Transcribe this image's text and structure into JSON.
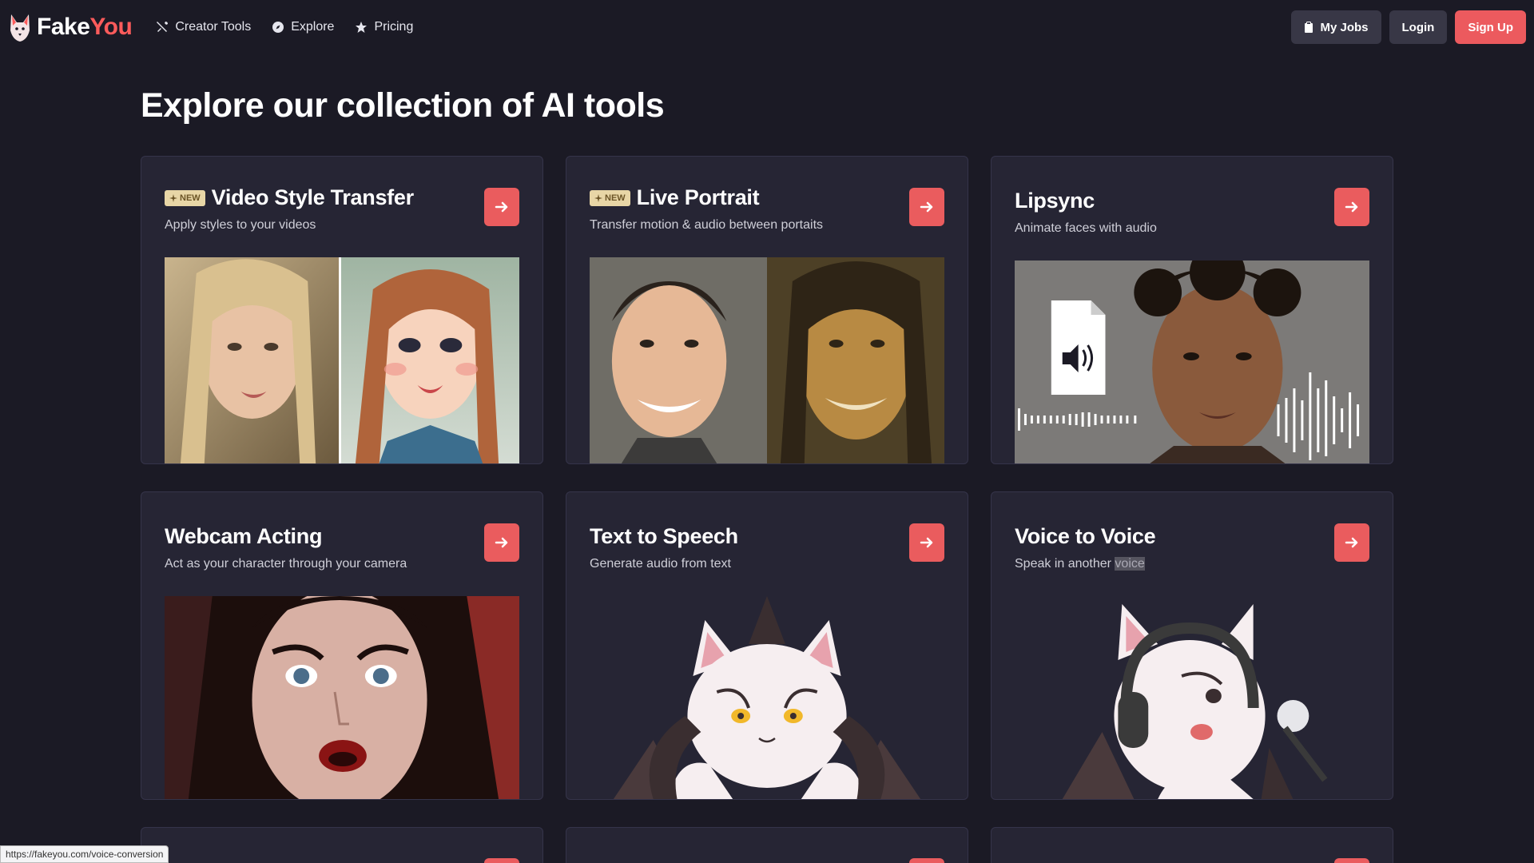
{
  "brand": {
    "name_part1": "Fake",
    "name_part2": "You"
  },
  "nav": {
    "items": [
      {
        "label": "Creator Tools",
        "icon": "tools-icon"
      },
      {
        "label": "Explore",
        "icon": "compass-icon"
      },
      {
        "label": "Pricing",
        "icon": "star-icon"
      }
    ],
    "my_jobs": "My Jobs",
    "login": "Login",
    "signup": "Sign Up"
  },
  "page": {
    "title": "Explore our collection of AI tools"
  },
  "cards": [
    {
      "title": "Video Style Transfer",
      "subtitle": "Apply styles to your videos",
      "badge": "NEW"
    },
    {
      "title": "Live Portrait",
      "subtitle": "Transfer motion & audio between portaits",
      "badge": "NEW"
    },
    {
      "title": "Lipsync",
      "subtitle": "Animate faces with audio"
    },
    {
      "title": "Webcam Acting",
      "subtitle": "Act as your character through your camera"
    },
    {
      "title": "Text to Speech",
      "subtitle": "Generate audio from text"
    },
    {
      "title": "Voice to Voice",
      "subtitle_pre": "Speak in another ",
      "subtitle_hl": "voice"
    }
  ],
  "status_url": "https://fakeyou.com/voice-conversion",
  "colors": {
    "accent": "#ec5a5e",
    "background": "#1b1a25",
    "card": "#262534"
  }
}
